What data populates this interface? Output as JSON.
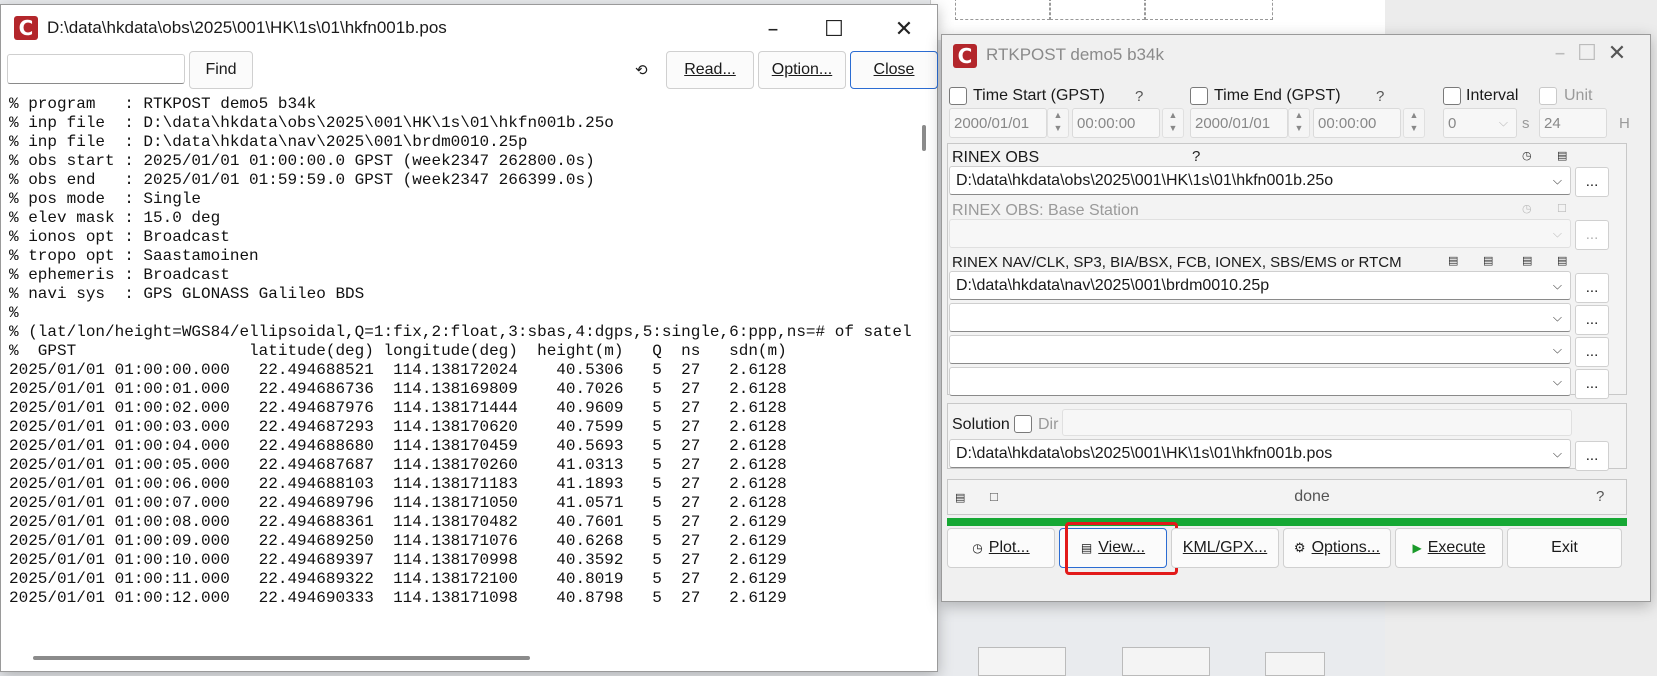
{
  "text_window": {
    "title": "D:\\data\\hkdata\\obs\\2025\\001\\HK\\1s\\01\\hkfn001b.pos",
    "find_value": "",
    "find_button": "Find",
    "refresh_icon": "refresh-icon",
    "read_button": "Read...",
    "option_button": "Option...",
    "close_button": "Close",
    "content": "% program   : RTKPOST demo5 b34k\n% inp file  : D:\\data\\hkdata\\obs\\2025\\001\\HK\\1s\\01\\hkfn001b.25o\n% inp file  : D:\\data\\hkdata\\nav\\2025\\001\\brdm0010.25p\n% obs start : 2025/01/01 01:00:00.0 GPST (week2347 262800.0s)\n% obs end   : 2025/01/01 01:59:59.0 GPST (week2347 266399.0s)\n% pos mode  : Single\n% elev mask : 15.0 deg\n% ionos opt : Broadcast\n% tropo opt : Saastamoinen\n% ephemeris : Broadcast\n% navi sys  : GPS GLONASS Galileo BDS\n%\n% (lat/lon/height=WGS84/ellipsoidal,Q=1:fix,2:float,3:sbas,4:dgps,5:single,6:ppp,ns=# of satellites)\n%  GPST                  latitude(deg) longitude(deg)  height(m)   Q  ns   sdn(m)\n2025/01/01 01:00:00.000   22.494688521  114.138172024    40.5306   5  27   2.6128\n2025/01/01 01:00:01.000   22.494686736  114.138169809    40.7026   5  27   2.6128\n2025/01/01 01:00:02.000   22.494687976  114.138171444    40.9609   5  27   2.6128\n2025/01/01 01:00:03.000   22.494687293  114.138170620    40.7599   5  27   2.6128\n2025/01/01 01:00:04.000   22.494688680  114.138170459    40.5693   5  27   2.6128\n2025/01/01 01:00:05.000   22.494687687  114.138170260    41.0313   5  27   2.6128\n2025/01/01 01:00:06.000   22.494688103  114.138171183    41.1893   5  27   2.6128\n2025/01/01 01:00:07.000   22.494689796  114.138171050    41.0571   5  27   2.6128\n2025/01/01 01:00:08.000   22.494688361  114.138170482    40.7601   5  27   2.6129\n2025/01/01 01:00:09.000   22.494689250  114.138171076    40.6268   5  27   2.6129\n2025/01/01 01:00:10.000   22.494689397  114.138170998    40.3592   5  27   2.6129\n2025/01/01 01:00:11.000   22.494689322  114.138172100    40.8019   5  27   2.6129\n2025/01/01 01:00:12.000   22.494690333  114.138171098    40.8798   5  27   2.6129"
  },
  "rtkpost": {
    "title": "RTKPOST demo5 b34k",
    "time_start_label": "Time Start (GPST)",
    "time_start_date": "2000/01/01",
    "time_start_time": "00:00:00",
    "time_end_label": "Time End (GPST)",
    "time_end_date": "2000/01/01",
    "time_end_time": "00:00:00",
    "interval_label": "Interval",
    "interval_value": "0",
    "interval_unit": "s",
    "unit_label": "Unit",
    "unit_value": "24",
    "unit_unit": "H",
    "help_mark": "?",
    "rinex_obs_label": "RINEX OBS",
    "rinex_obs_value": "D:\\data\\hkdata\\obs\\2025\\001\\HK\\1s\\01\\hkfn001b.25o",
    "base_label": "RINEX OBS: Base Station",
    "base_value": "",
    "nav_label": "RINEX NAV/CLK, SP3, BIA/BSX, FCB, IONEX, SBS/EMS  or RTCM",
    "nav_values": [
      "D:\\data\\hkdata\\nav\\2025\\001\\brdm0010.25p",
      "",
      "",
      ""
    ],
    "solution_label": "Solution",
    "dir_label": "Dir",
    "dir_value": "",
    "solution_value": "D:\\data\\hkdata\\obs\\2025\\001\\HK\\1s\\01\\hkfn001b.pos",
    "status": "done",
    "progress": 1.0,
    "browse": "...",
    "buttons": {
      "plot": "Plot...",
      "view": "View...",
      "kml": "KML/GPX...",
      "options": "Options...",
      "execute": "Execute",
      "exit": "Exit"
    }
  },
  "colors": {
    "logo": "#b3262b",
    "progress": "#16a834",
    "highlight": "#e21a1a",
    "primary_border": "#2b6cd2"
  }
}
